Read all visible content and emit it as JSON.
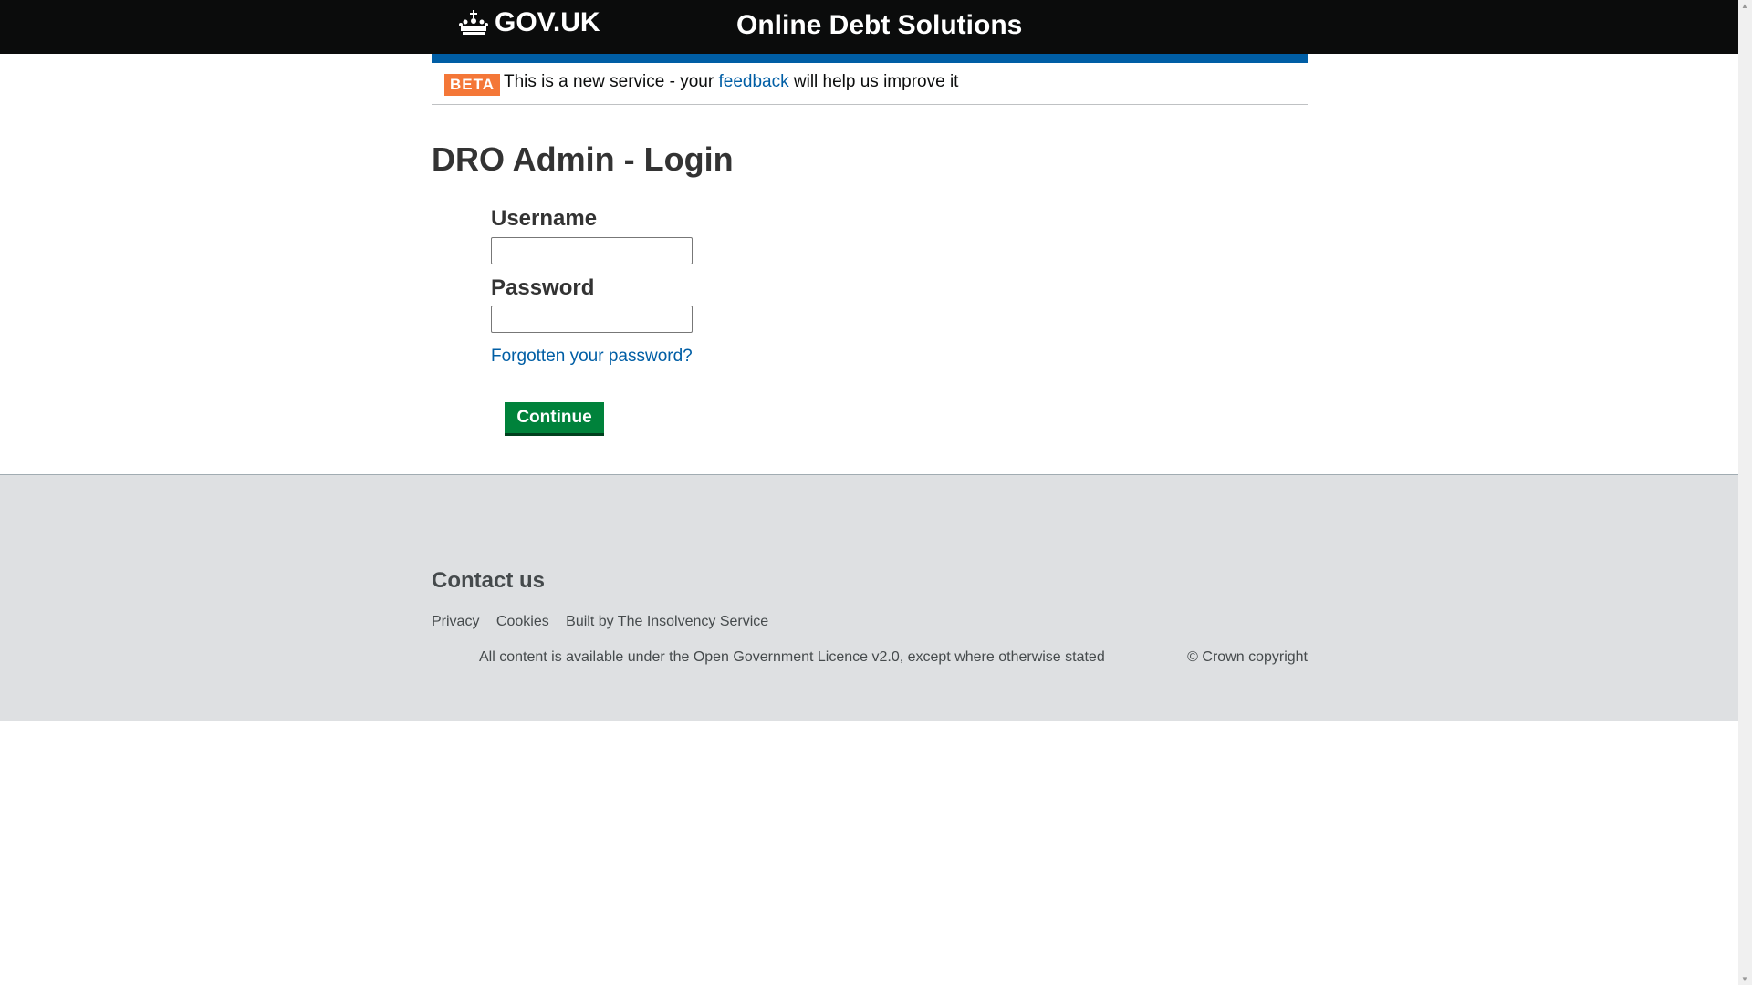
{
  "header": {
    "logo": "GOV.UK",
    "service_name": "Online Debt Solutions"
  },
  "beta_banner": {
    "tag": "BETA",
    "text_before": "This is a new service - your",
    "link": "feedback",
    "text_after": "will help us improve it"
  },
  "main": {
    "title": "DRO Admin - Login",
    "username_label": "Username",
    "username_value": "",
    "password_label": "Password",
    "password_value": "",
    "forgot_link": "Forgotten your password?",
    "continue_label": "Continue"
  },
  "footer": {
    "contact": "Contact us",
    "links": [
      "Privacy",
      "Cookies",
      "Built by The Insolvency Service"
    ],
    "licence": "All content is available under the Open Government Licence v2.0, except where otherwise stated",
    "copyright": "© Crown copyright"
  },
  "colors": {
    "header": "#0b0c0c",
    "blue": "#005ea5",
    "beta": "#f47738",
    "button": "#00823b",
    "footer": "#dee0e2"
  }
}
